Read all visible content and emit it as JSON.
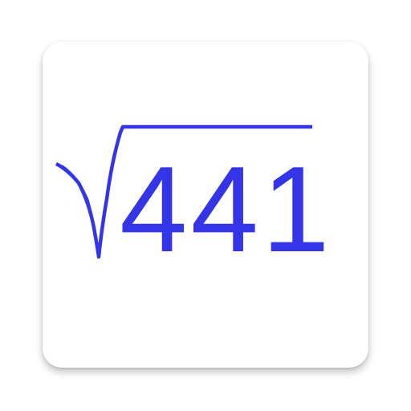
{
  "icon": {
    "radicand": "441",
    "symbol": "square-root-symbol",
    "colors": {
      "accent": "#3434e8",
      "background": "#ffffff"
    }
  }
}
